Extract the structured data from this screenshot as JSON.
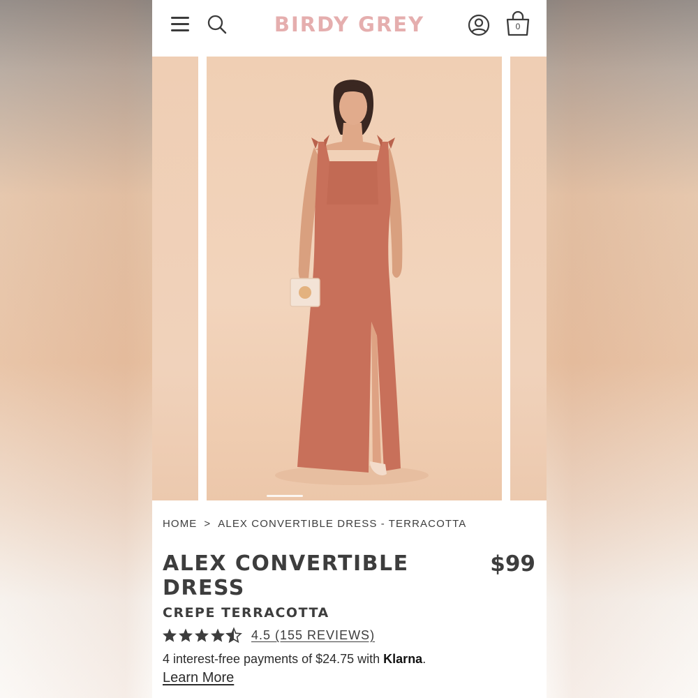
{
  "header": {
    "logo": "BIRDY GREY",
    "bag_count": "0"
  },
  "carousel": {
    "slide_count_visible": 3,
    "active_index": 1
  },
  "breadcrumb": {
    "home": "HOME",
    "separator": ">",
    "current": "ALEX CONVERTIBLE DRESS - TERRACOTTA"
  },
  "product": {
    "title": "ALEX CONVERTIBLE DRESS",
    "price": "$99",
    "subtitle": "CREPE TERRACOTTA",
    "rating_value": 4.5,
    "rating_max": 5,
    "rating_text": "4.5 (155 REVIEWS)"
  },
  "payments": {
    "text_before": "4 interest-free payments of $24.75 with ",
    "brand": "Klarna",
    "text_after": ".",
    "learn_more": "Learn More"
  },
  "colors": {
    "logo": "#e5aeae",
    "text": "#3d3d3d",
    "dress": "#c8705a",
    "backdrop": "#f0cfb4"
  }
}
